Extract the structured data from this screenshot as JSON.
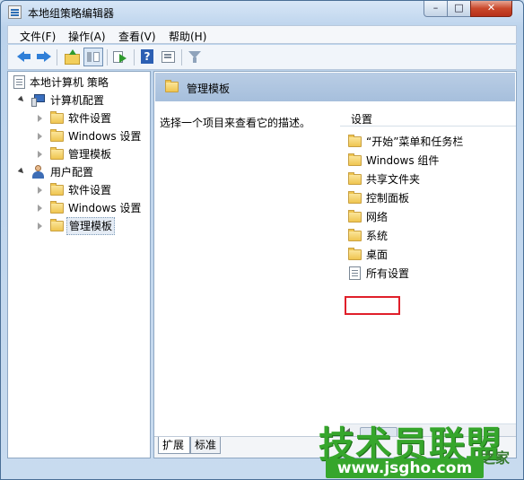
{
  "window": {
    "title": "本地组策略编辑器",
    "controls": {
      "minimize": "–",
      "maximize": "□",
      "close": "✕"
    }
  },
  "menu": [
    "文件(F)",
    "操作(A)",
    "查看(V)",
    "帮助(H)"
  ],
  "tree": {
    "root": "本地计算机 策略",
    "computer_config": "计算机配置",
    "computer_children": [
      "软件设置",
      "Windows 设置",
      "管理模板"
    ],
    "user_config": "用户配置",
    "user_children": [
      "软件设置",
      "Windows 设置",
      "管理模板"
    ]
  },
  "details": {
    "header_title": "管理模板",
    "description": "选择一个项目来查看它的描述。",
    "column_header": "设置",
    "items": [
      "“开始”菜单和任务栏",
      "Windows 组件",
      "共享文件夹",
      "控制面板",
      "网络",
      "系统",
      "桌面",
      "所有设置"
    ],
    "highlighted_item": "系统"
  },
  "tabs": [
    "扩展",
    "标准"
  ],
  "watermark": {
    "main": "技术员联盟",
    "side": "之家",
    "url": "www.jsgho.com"
  },
  "colors": {
    "highlight_border": "#e01f2a",
    "watermark_green": "#36a62c"
  }
}
